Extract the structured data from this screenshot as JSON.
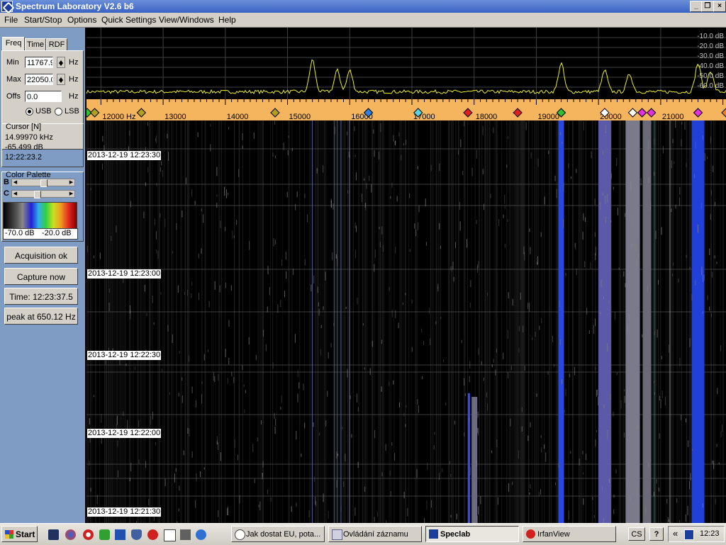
{
  "window": {
    "title": "Spectrum Laboratory V2.6 b6",
    "minimize": "_",
    "restore": "❐",
    "close": "×"
  },
  "menu": [
    "File",
    "Start/Stop",
    "Options",
    "Quick Settings",
    "View/Windows",
    "Help"
  ],
  "left_panel": {
    "tabs": [
      "Freq",
      "Time",
      "RDF"
    ],
    "active_tab": "Freq",
    "min_label": "Min",
    "min_value": "11767.9",
    "max_label": "Max",
    "max_value": "22050.0",
    "offs_label": "Offs",
    "offs_value": "0.0",
    "hz": "Hz",
    "usb": "USB",
    "lsb": "LSB",
    "sideband_selected": "USB",
    "cursor": {
      "title": "Cursor [N]",
      "freq": "14.99970 kHz",
      "level": "-65.499 dB",
      "time": "12:22:23.2"
    },
    "palette": {
      "title": "Color Palette",
      "b": "B",
      "c": "C",
      "brightness": 0.5,
      "contrast": 0.35,
      "min_db": "-70.0 dB",
      "max_db": "-20.0 dB"
    },
    "buttons": {
      "acquisition": "Acquisition ok",
      "capture": "Capture now",
      "time": "Time:  12:23:37.5",
      "peak": "peak at 650.12 Hz"
    }
  },
  "spectrum": {
    "db_labels": [
      "-10.0 dB",
      "-20.0 dB",
      "-30.0 dB",
      "-40.0 dB",
      "-50.0 dB",
      "-60.0 dB"
    ],
    "trace_color": "#f0f020"
  },
  "freq_scale": {
    "labels": [
      {
        "text": "12000  Hz",
        "freq": 12000
      },
      {
        "text": "13000",
        "freq": 13000
      },
      {
        "text": "14000",
        "freq": 14000
      },
      {
        "text": "15000",
        "freq": 15000
      },
      {
        "text": "16000",
        "freq": 16000
      },
      {
        "text": "17000",
        "freq": 17000
      },
      {
        "text": "18000",
        "freq": 18000
      },
      {
        "text": "19000",
        "freq": 19000
      },
      {
        "text": "20000",
        "freq": 20000
      },
      {
        "text": "21000",
        "freq": 21000
      }
    ],
    "min_freq": 11767.9,
    "max_freq": 22050.0,
    "markers": [
      {
        "freq": 11780,
        "color": "#30c030"
      },
      {
        "freq": 11900,
        "color": "#b0a020"
      },
      {
        "freq": 12650,
        "color": "#b0a020"
      },
      {
        "freq": 14800,
        "color": "#b0a020"
      },
      {
        "freq": 16300,
        "color": "#3080e0"
      },
      {
        "freq": 17100,
        "color": "#60d0e0"
      },
      {
        "freq": 17900,
        "color": "#e02020"
      },
      {
        "freq": 18700,
        "color": "#e02020"
      },
      {
        "freq": 19400,
        "color": "#30c030"
      },
      {
        "freq": 20100,
        "color": "#ffffff"
      },
      {
        "freq": 20550,
        "color": "#ffffff"
      },
      {
        "freq": 20700,
        "color": "#e030e0"
      },
      {
        "freq": 20850,
        "color": "#e030e0"
      },
      {
        "freq": 21600,
        "color": "#e030e0"
      },
      {
        "freq": 22050,
        "color": "#f08020"
      }
    ]
  },
  "waterfall": {
    "timestamps": [
      "2013-12-19 12:23:30",
      "2013-12-19 12:23:00",
      "2013-12-19 12:22:30",
      "2013-12-19 12:22:00",
      "2013-12-19 12:21:30"
    ]
  },
  "taskbar": {
    "start": "Start",
    "tasks": [
      "Jak dostat EU, pota...",
      "Ovládání záznamu",
      "Speclab",
      "IrfanView"
    ],
    "active_task": "Speclab",
    "lang": "CS",
    "help": "?",
    "chevron": "«",
    "clock": "12:23"
  }
}
